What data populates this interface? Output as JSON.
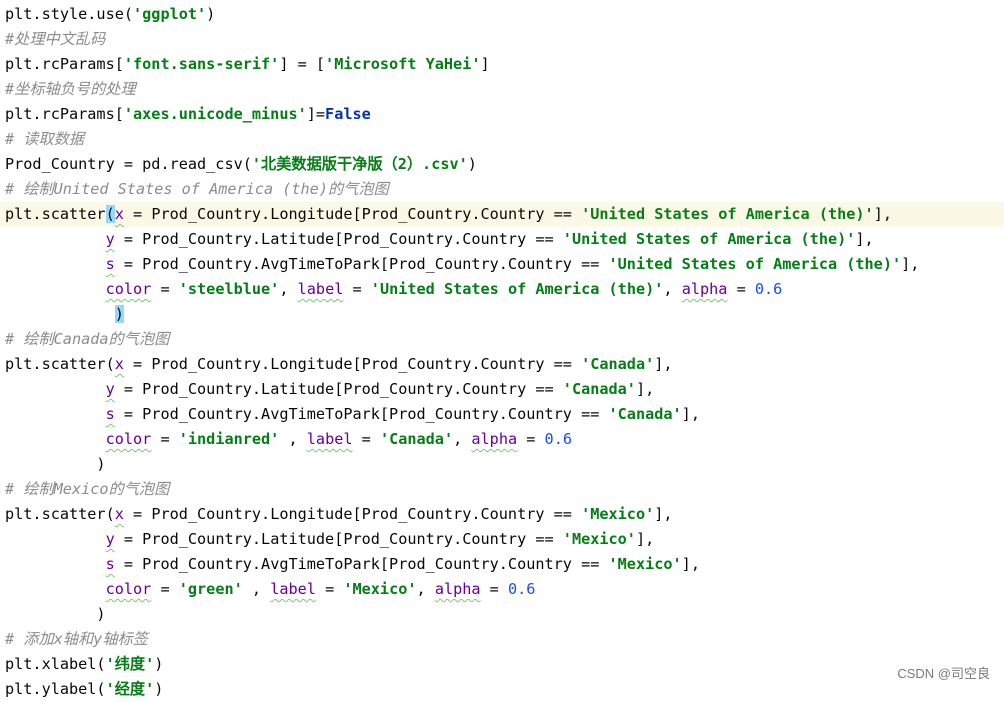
{
  "editor": {
    "lines": [
      {
        "tokens": [
          {
            "t": "plt.style.use("
          },
          {
            "t": "'ggplot'",
            "c": "str"
          },
          {
            "t": ")"
          }
        ]
      },
      {
        "tokens": [
          {
            "t": "#处理中文乱码",
            "c": "cmt"
          }
        ]
      },
      {
        "tokens": [
          {
            "t": "plt.rcParams["
          },
          {
            "t": "'font.sans-serif'",
            "c": "str"
          },
          {
            "t": "] = ["
          },
          {
            "t": "'Microsoft YaHei'",
            "c": "str"
          },
          {
            "t": "]"
          }
        ]
      },
      {
        "tokens": [
          {
            "t": "#坐标轴负号的处理",
            "c": "cmt"
          }
        ]
      },
      {
        "tokens": [
          {
            "t": "plt.rcParams["
          },
          {
            "t": "'axes.unicode_minus'",
            "c": "str"
          },
          {
            "t": "]="
          },
          {
            "t": "False",
            "c": "kw bold"
          }
        ]
      },
      {
        "tokens": [
          {
            "t": "# 读取数据",
            "c": "cmt"
          }
        ]
      },
      {
        "tokens": [
          {
            "t": "Prod_Country = pd.read_csv("
          },
          {
            "t": "'北美数据版干净版（2）.csv'",
            "c": "str"
          },
          {
            "t": ")"
          }
        ]
      },
      {
        "tokens": [
          {
            "t": "# 绘制United States of America (the)的气泡图",
            "c": "cmt"
          }
        ]
      },
      {
        "current": true,
        "tokens": [
          {
            "t": "plt.scatter"
          },
          {
            "t": "(",
            "c": "bracket-hl"
          },
          {
            "t": "x",
            "c": "kwarg"
          },
          {
            "t": " = Prod_Country.Longitude[Prod_Country.Country == "
          },
          {
            "t": "'United States of America (the)'",
            "c": "str"
          },
          {
            "t": "],"
          }
        ]
      },
      {
        "tokens": [
          {
            "t": "           "
          },
          {
            "t": "y",
            "c": "kwarg"
          },
          {
            "t": " = Prod_Country.Latitude[Prod_Country.Country == "
          },
          {
            "t": "'United States of America (the)'",
            "c": "str"
          },
          {
            "t": "],"
          }
        ]
      },
      {
        "tokens": [
          {
            "t": "           "
          },
          {
            "t": "s",
            "c": "kwarg"
          },
          {
            "t": " = Prod_Country.AvgTimeToPark[Prod_Country.Country == "
          },
          {
            "t": "'United States of America (the)'",
            "c": "str"
          },
          {
            "t": "],"
          }
        ]
      },
      {
        "tokens": [
          {
            "t": "           "
          },
          {
            "t": "color",
            "c": "kwarg"
          },
          {
            "t": " = "
          },
          {
            "t": "'steelblue'",
            "c": "str"
          },
          {
            "t": ", "
          },
          {
            "t": "label",
            "c": "kwarg"
          },
          {
            "t": " = "
          },
          {
            "t": "'United States of America (the)'",
            "c": "str"
          },
          {
            "t": ", "
          },
          {
            "t": "alpha",
            "c": "kwarg"
          },
          {
            "t": " = "
          },
          {
            "t": "0.6",
            "c": "num"
          }
        ]
      },
      {
        "tokens": [
          {
            "t": "            "
          },
          {
            "t": ")",
            "c": "bracket-hl"
          }
        ]
      },
      {
        "tokens": [
          {
            "t": "# 绘制Canada的气泡图",
            "c": "cmt"
          }
        ]
      },
      {
        "tokens": [
          {
            "t": "plt.scatter("
          },
          {
            "t": "x",
            "c": "kwarg"
          },
          {
            "t": " = Prod_Country.Longitude[Prod_Country.Country == "
          },
          {
            "t": "'Canada'",
            "c": "str"
          },
          {
            "t": "],"
          }
        ]
      },
      {
        "tokens": [
          {
            "t": "           "
          },
          {
            "t": "y",
            "c": "kwarg"
          },
          {
            "t": " = Prod_Country.Latitude[Prod_Country.Country == "
          },
          {
            "t": "'Canada'",
            "c": "str"
          },
          {
            "t": "],"
          }
        ]
      },
      {
        "tokens": [
          {
            "t": "           "
          },
          {
            "t": "s",
            "c": "kwarg"
          },
          {
            "t": " = Prod_Country.AvgTimeToPark[Prod_Country.Country == "
          },
          {
            "t": "'Canada'",
            "c": "str"
          },
          {
            "t": "],"
          }
        ]
      },
      {
        "tokens": [
          {
            "t": "           "
          },
          {
            "t": "color",
            "c": "kwarg"
          },
          {
            "t": " = "
          },
          {
            "t": "'indianred'",
            "c": "str"
          },
          {
            "t": " , "
          },
          {
            "t": "label",
            "c": "kwarg"
          },
          {
            "t": " = "
          },
          {
            "t": "'Canada'",
            "c": "str"
          },
          {
            "t": ", "
          },
          {
            "t": "alpha",
            "c": "kwarg"
          },
          {
            "t": " = "
          },
          {
            "t": "0.6",
            "c": "num"
          }
        ]
      },
      {
        "tokens": [
          {
            "t": "          )"
          }
        ]
      },
      {
        "tokens": [
          {
            "t": "# 绘制Mexico的气泡图",
            "c": "cmt"
          }
        ]
      },
      {
        "tokens": [
          {
            "t": "plt.scatter("
          },
          {
            "t": "x",
            "c": "kwarg"
          },
          {
            "t": " = Prod_Country.Longitude[Prod_Country.Country == "
          },
          {
            "t": "'Mexico'",
            "c": "str"
          },
          {
            "t": "],"
          }
        ]
      },
      {
        "tokens": [
          {
            "t": "           "
          },
          {
            "t": "y",
            "c": "kwarg"
          },
          {
            "t": " = Prod_Country.Latitude[Prod_Country.Country == "
          },
          {
            "t": "'Mexico'",
            "c": "str"
          },
          {
            "t": "],"
          }
        ]
      },
      {
        "tokens": [
          {
            "t": "           "
          },
          {
            "t": "s",
            "c": "kwarg"
          },
          {
            "t": " = Prod_Country.AvgTimeToPark[Prod_Country.Country == "
          },
          {
            "t": "'Mexico'",
            "c": "str"
          },
          {
            "t": "],"
          }
        ]
      },
      {
        "tokens": [
          {
            "t": "           "
          },
          {
            "t": "color",
            "c": "kwarg"
          },
          {
            "t": " = "
          },
          {
            "t": "'green'",
            "c": "str"
          },
          {
            "t": " , "
          },
          {
            "t": "label",
            "c": "kwarg"
          },
          {
            "t": " = "
          },
          {
            "t": "'Mexico'",
            "c": "str"
          },
          {
            "t": ", "
          },
          {
            "t": "alpha",
            "c": "kwarg"
          },
          {
            "t": " = "
          },
          {
            "t": "0.6",
            "c": "num"
          }
        ]
      },
      {
        "tokens": [
          {
            "t": "          )"
          }
        ]
      },
      {
        "tokens": [
          {
            "t": "# 添加x轴和y轴标签",
            "c": "cmt"
          }
        ]
      },
      {
        "tokens": [
          {
            "t": "plt.xlabel("
          },
          {
            "t": "'纬度'",
            "c": "str"
          },
          {
            "t": ")"
          }
        ]
      },
      {
        "tokens": [
          {
            "t": "plt.ylabel("
          },
          {
            "t": "'经度'",
            "c": "str"
          },
          {
            "t": ")"
          }
        ]
      }
    ]
  },
  "watermark": "CSDN @司空良"
}
